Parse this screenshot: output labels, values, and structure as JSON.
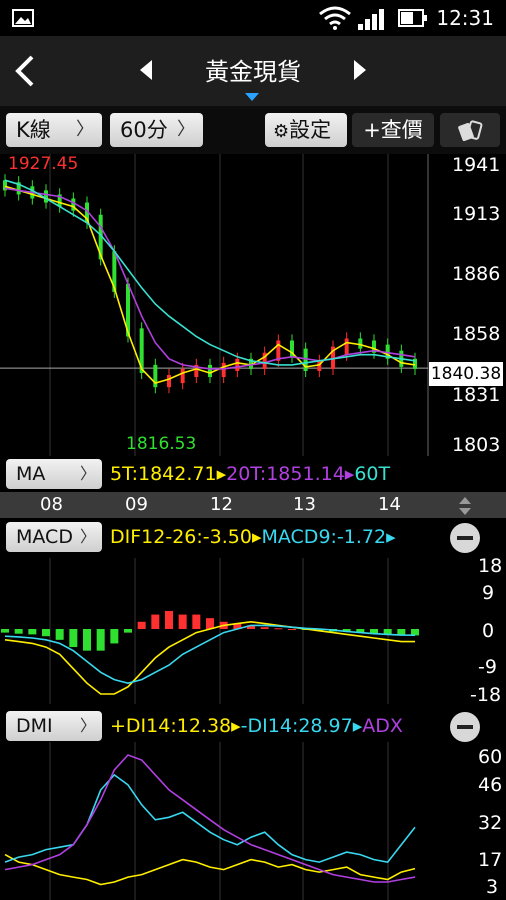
{
  "status_bar": {
    "time": "12:31"
  },
  "nav": {
    "title": "黃金現貨"
  },
  "toolbar": {
    "chart_type": "K線",
    "interval": "60分",
    "settings": "設定",
    "add_quote": "+查價"
  },
  "colors": {
    "ma5": "#ffee00",
    "ma20": "#b040e0",
    "ma60": "#38e0d0",
    "up": "#ff3030",
    "down": "#30e030"
  },
  "price_axis": {
    "labels": [
      "1941",
      "1913",
      "1886",
      "1858",
      "1831",
      "1803"
    ],
    "current": "1840.38",
    "high_mark": "1927.45",
    "low_mark": "1816.53"
  },
  "ma_panel": {
    "button": "MA",
    "t5": "5T:1842.71",
    "t20": "20T:1851.14",
    "t60": "60T"
  },
  "time_axis": {
    "labels": [
      "08",
      "09",
      "12",
      "13",
      "14"
    ]
  },
  "macd_panel": {
    "button": "MACD",
    "dif": "DIF12-26:-3.50",
    "macd": "MACD9:-1.72",
    "labels": [
      "18",
      "9",
      "0",
      "-9",
      "-18"
    ]
  },
  "dmi_panel": {
    "button": "DMI",
    "pdi": "+DI14:12.38",
    "mdi": "-DI14:28.97",
    "adx": "ADX",
    "labels": [
      "60",
      "46",
      "32",
      "17",
      "3"
    ]
  },
  "chart_data": [
    {
      "type": "line",
      "title": "",
      "series": [
        {
          "name": "5T",
          "values": [
            1930,
            1928,
            1926,
            1924,
            1922,
            1920,
            1914,
            1896,
            1880,
            1858,
            1840,
            1833,
            1835,
            1838,
            1840,
            1838,
            1841,
            1843,
            1842,
            1846,
            1852,
            1848,
            1841,
            1842,
            1849,
            1853,
            1852,
            1850,
            1847,
            1843,
            1842
          ]
        },
        {
          "name": "20T",
          "values": [
            1929,
            1928,
            1927,
            1926,
            1925,
            1922,
            1918,
            1910,
            1898,
            1882,
            1866,
            1853,
            1845,
            1842,
            1841,
            1840,
            1840,
            1841,
            1842,
            1843,
            1845,
            1846,
            1845,
            1844,
            1845,
            1847,
            1848,
            1849,
            1848,
            1847,
            1846
          ]
        },
        {
          "name": "60T",
          "values": [
            1933,
            1931,
            1928,
            1924,
            1920,
            1916,
            1912,
            1906,
            1898,
            1889,
            1880,
            1872,
            1866,
            1861,
            1856,
            1852,
            1849,
            1846,
            1844,
            1843,
            1842,
            1842,
            1843,
            1844,
            1845,
            1846,
            1847,
            1847,
            1846,
            1845,
            1844
          ]
        }
      ],
      "ylim": [
        1803,
        1941
      ]
    },
    {
      "type": "bar",
      "title": "",
      "series": [
        {
          "name": "DIF12-26",
          "values": [
            -3,
            -3.5,
            -4,
            -5,
            -7,
            -11,
            -15,
            -18,
            -18,
            -16,
            -12,
            -8,
            -5,
            -3,
            -1,
            0,
            1,
            1.5,
            2,
            1.5,
            1,
            0.5,
            0,
            -0.5,
            -1,
            -1.5,
            -2,
            -2.5,
            -3,
            -3.5,
            -3.5
          ]
        },
        {
          "name": "MACD9",
          "values": [
            -2,
            -2.2,
            -2.5,
            -3,
            -4,
            -6,
            -9,
            -12,
            -14,
            -15,
            -14,
            -12,
            -10,
            -7,
            -5,
            -3,
            -1,
            0,
            1,
            1,
            0.8,
            0.5,
            0.2,
            0,
            -0.3,
            -0.7,
            -1,
            -1.3,
            -1.5,
            -1.7,
            -1.72
          ]
        }
      ],
      "ylim": [
        -18,
        18
      ]
    },
    {
      "type": "line",
      "title": "",
      "series": [
        {
          "name": "+DI14",
          "values": [
            18,
            15,
            14,
            12,
            10,
            9,
            8,
            6,
            7,
            9,
            10,
            12,
            14,
            16,
            15,
            13,
            12,
            14,
            16,
            15,
            13,
            14,
            12,
            11,
            12,
            13,
            10,
            9,
            8,
            11,
            12.38
          ]
        },
        {
          "name": "-DI14",
          "values": [
            15,
            17,
            18,
            20,
            21,
            22,
            30,
            44,
            50,
            46,
            38,
            32,
            33,
            35,
            31,
            27,
            24,
            22,
            25,
            27,
            22,
            18,
            16,
            15,
            17,
            19,
            18,
            16,
            15,
            22,
            28.97
          ]
        },
        {
          "name": "ADX",
          "values": [
            12,
            13,
            14,
            16,
            18,
            22,
            30,
            40,
            52,
            58,
            56,
            50,
            44,
            40,
            36,
            32,
            28,
            25,
            22,
            20,
            18,
            16,
            14,
            12,
            10,
            9,
            8,
            7,
            7,
            8,
            9
          ]
        }
      ],
      "ylim": [
        3,
        60
      ]
    }
  ]
}
